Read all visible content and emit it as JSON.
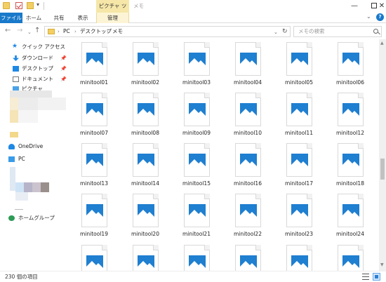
{
  "window": {
    "title": "メモ",
    "tool_tab_header": "ピクチャ ツール"
  },
  "ribbon": {
    "tabs": [
      "ファイル",
      "ホーム",
      "共有",
      "表示",
      "管理"
    ]
  },
  "address": {
    "breadcrumbs": [
      "PC",
      "デスクトップ",
      "メモ"
    ],
    "search_placeholder": "メモの検索"
  },
  "sidebar": {
    "quick_access": "クイック アクセス",
    "items": [
      {
        "label": "ダウンロード",
        "icon": "download-icon"
      },
      {
        "label": "デスクトップ",
        "icon": "desktop-icon"
      },
      {
        "label": "ドキュメント",
        "icon": "document-icon"
      },
      {
        "label": "ピクチャ",
        "icon": "pictures-icon"
      }
    ],
    "onedrive": "OneDrive",
    "pc": "PC",
    "homegroup": "ホームグループ"
  },
  "files": [
    "minitool01",
    "minitool02",
    "minitool03",
    "minitool04",
    "minitool05",
    "minitool06",
    "minitool07",
    "minitool08",
    "minitool09",
    "minitool10",
    "minitool11",
    "minitool12",
    "minitool13",
    "minitool14",
    "minitool15",
    "minitool16",
    "minitool17",
    "minitool18",
    "minitool19",
    "minitool20",
    "minitool21",
    "minitool22",
    "minitool23",
    "minitool24",
    "",
    "",
    "",
    "",
    "",
    ""
  ],
  "status": {
    "item_count": "230 個の項目"
  },
  "colors": {
    "accent": "#1979ca",
    "image_thumb": "#1f7fd0",
    "tool_tab": "#f6e7a8"
  }
}
